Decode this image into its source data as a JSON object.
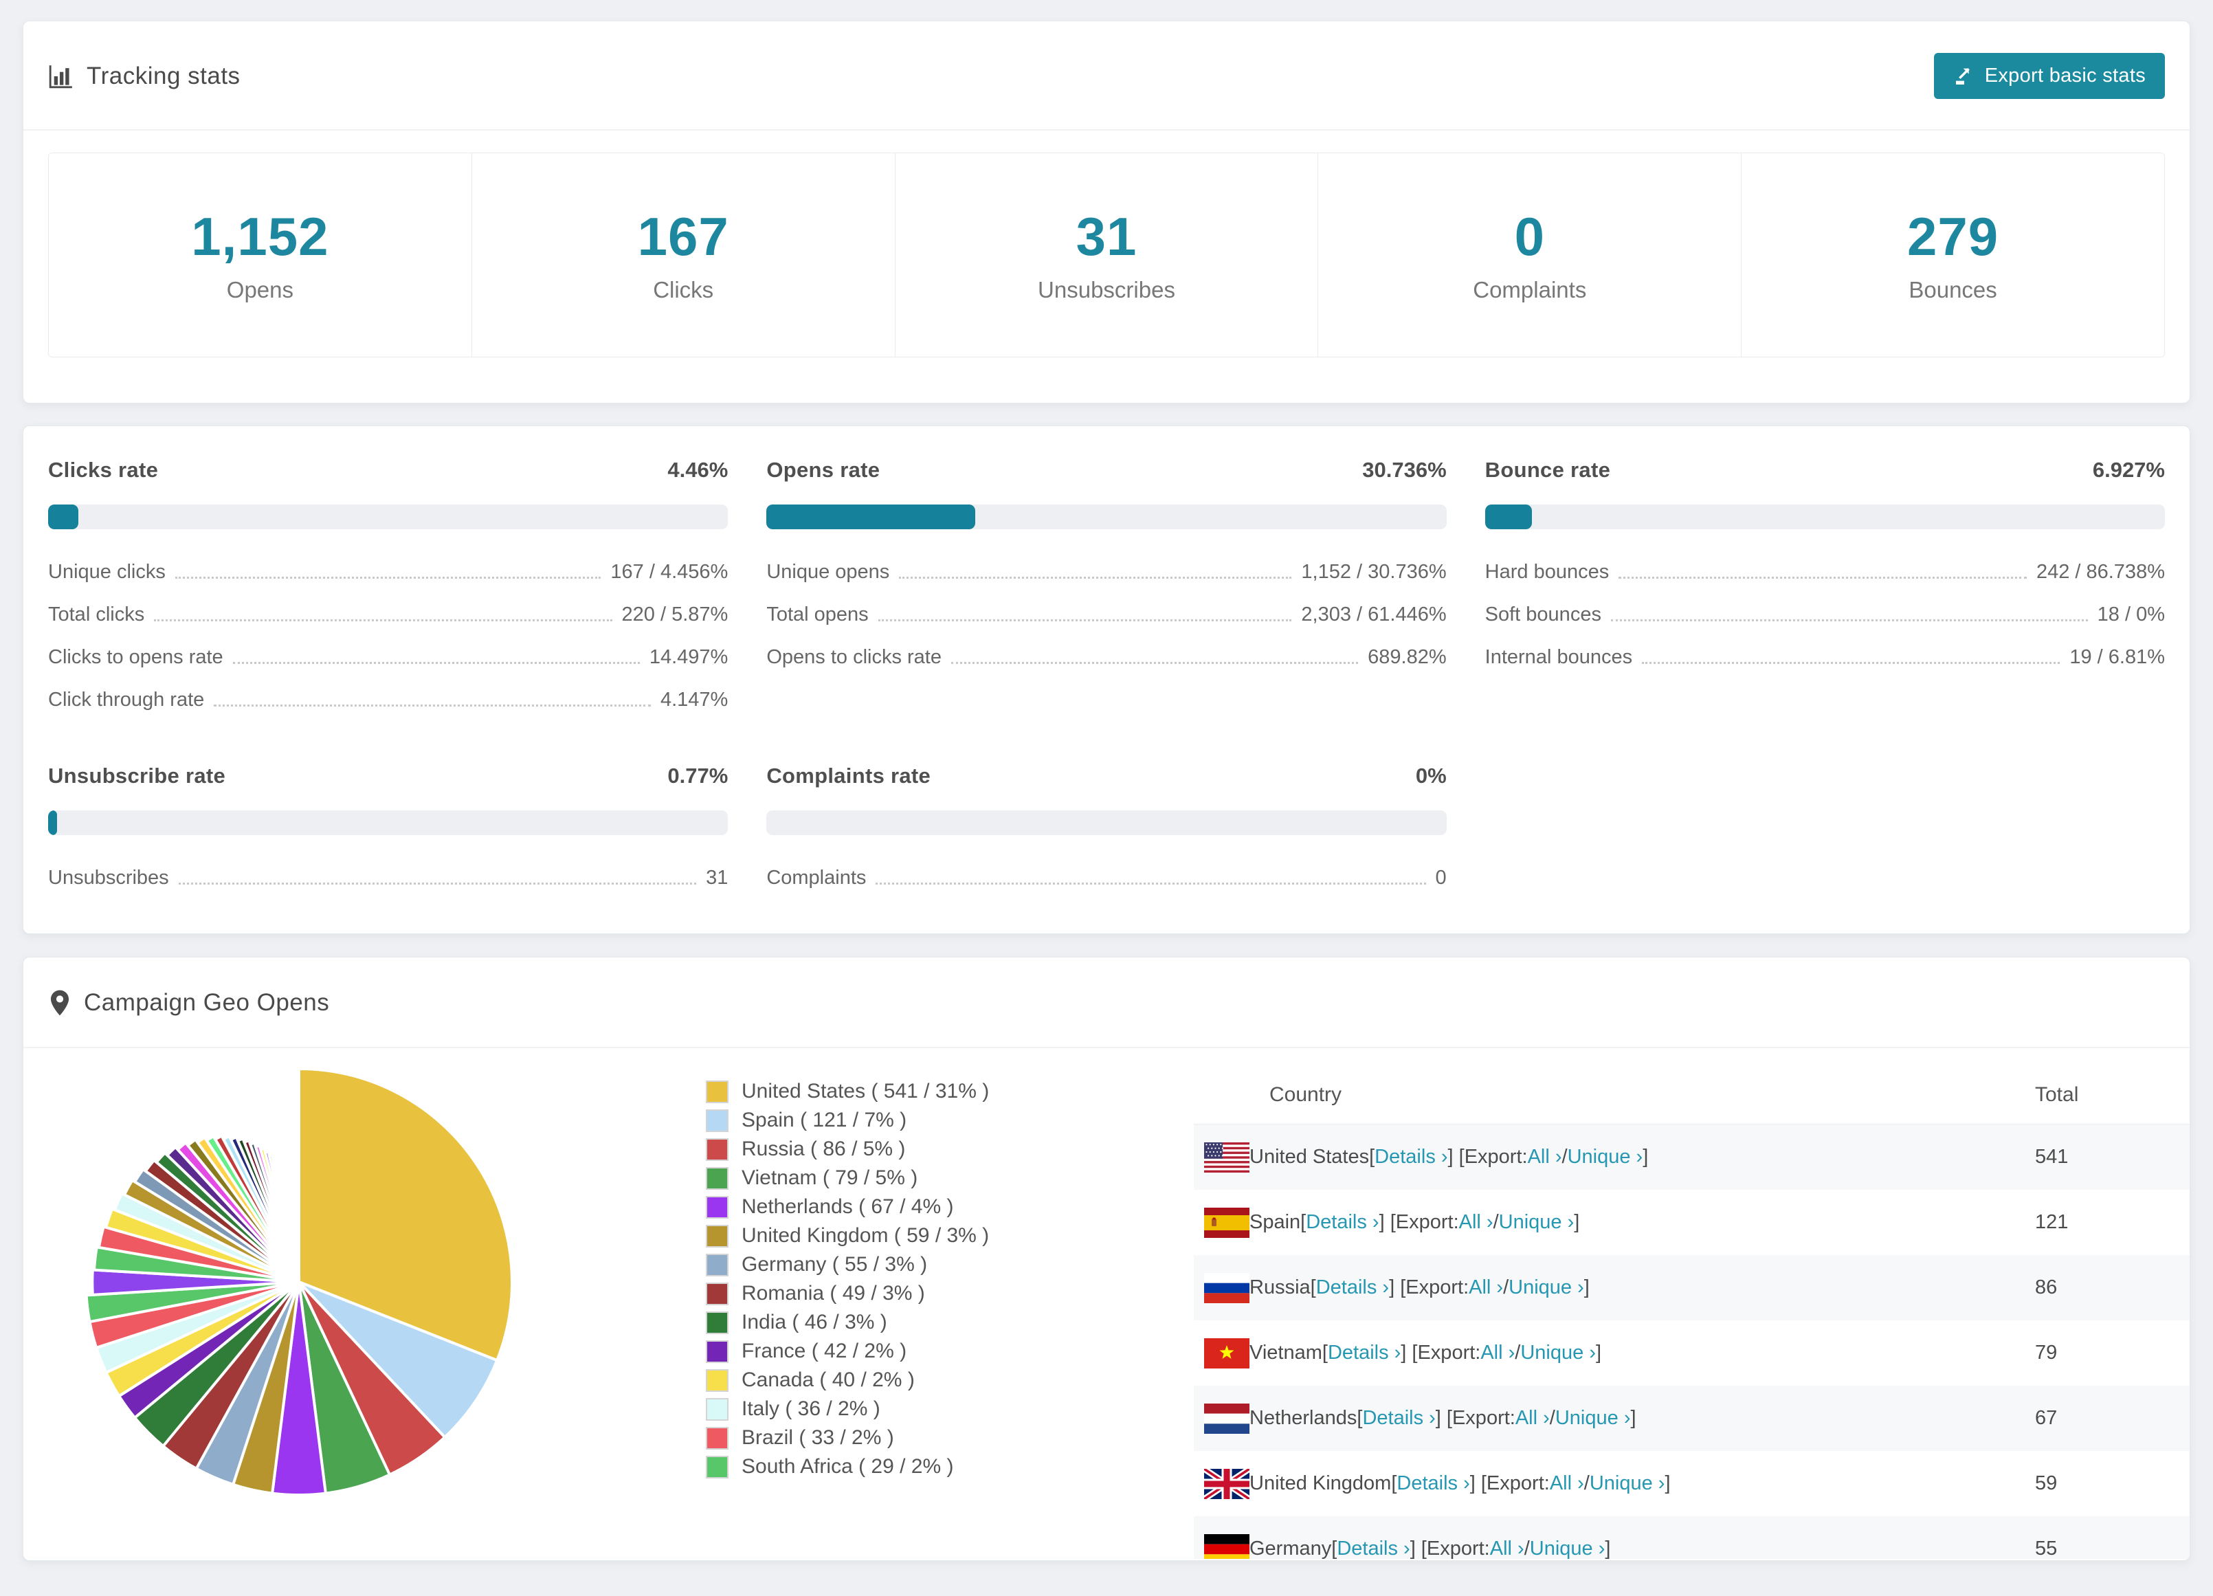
{
  "tracking": {
    "title": "Tracking stats",
    "export_button": "Export basic stats",
    "summary": [
      {
        "value": "1,152",
        "label": "Opens"
      },
      {
        "value": "167",
        "label": "Clicks"
      },
      {
        "value": "31",
        "label": "Unsubscribes"
      },
      {
        "value": "0",
        "label": "Complaints"
      },
      {
        "value": "279",
        "label": "Bounces"
      }
    ]
  },
  "rates": {
    "panels": [
      {
        "title": "Clicks rate",
        "value": "4.46%",
        "percent": 4.46,
        "rows": [
          {
            "label": "Unique clicks",
            "value": "167 / 4.456%"
          },
          {
            "label": "Total clicks",
            "value": "220 / 5.87%"
          },
          {
            "label": "Clicks to opens rate",
            "value": "14.497%"
          },
          {
            "label": "Click through rate",
            "value": "4.147%"
          }
        ]
      },
      {
        "title": "Opens rate",
        "value": "30.736%",
        "percent": 30.736,
        "rows": [
          {
            "label": "Unique opens",
            "value": "1,152 / 30.736%"
          },
          {
            "label": "Total opens",
            "value": "2,303 / 61.446%"
          },
          {
            "label": "Opens to clicks rate",
            "value": "689.82%"
          }
        ]
      },
      {
        "title": "Bounce rate",
        "value": "6.927%",
        "percent": 6.927,
        "rows": [
          {
            "label": "Hard bounces",
            "value": "242 / 86.738%"
          },
          {
            "label": "Soft bounces",
            "value": "18 / 0%"
          },
          {
            "label": "Internal bounces",
            "value": "19 / 6.81%"
          }
        ]
      },
      {
        "title": "Unsubscribe rate",
        "value": "0.77%",
        "percent": 0.77,
        "rows": [
          {
            "label": "Unsubscribes",
            "value": "31"
          }
        ]
      },
      {
        "title": "Complaints rate",
        "value": "0%",
        "percent": 0,
        "rows": [
          {
            "label": "Complaints",
            "value": "0"
          }
        ]
      }
    ]
  },
  "geo": {
    "title": "Campaign Geo Opens",
    "table": {
      "headers": {
        "country": "Country",
        "total": "Total"
      },
      "segments": {
        "pre_details": "[",
        "post_details": "] [Export: ",
        "mid": " / ",
        "end": "]"
      },
      "links": {
        "details": "Details ›",
        "all": "All ›",
        "unique": "Unique ›"
      },
      "rows": [
        {
          "flag": "us",
          "country": "United States",
          "total": "541"
        },
        {
          "flag": "es",
          "country": "Spain",
          "total": "121"
        },
        {
          "flag": "ru",
          "country": "Russia",
          "total": "86"
        },
        {
          "flag": "vn",
          "country": "Vietnam",
          "total": "79"
        },
        {
          "flag": "nl",
          "country": "Netherlands",
          "total": "67"
        },
        {
          "flag": "gb",
          "country": "United Kingdom",
          "total": "59"
        },
        {
          "flag": "de",
          "country": "Germany",
          "total": "55"
        }
      ]
    }
  },
  "chart_data": {
    "type": "pie",
    "title": "Campaign Geo Opens",
    "unit": "opens",
    "legend_position": "right",
    "slices": [
      {
        "label": "United States",
        "count": 541,
        "percent": 31,
        "color": "#e8c23e"
      },
      {
        "label": "Spain",
        "count": 121,
        "percent": 7,
        "color": "#b5d9f5"
      },
      {
        "label": "Russia",
        "count": 86,
        "percent": 5,
        "color": "#cc4a4a"
      },
      {
        "label": "Vietnam",
        "count": 79,
        "percent": 5,
        "color": "#4ba450"
      },
      {
        "label": "Netherlands",
        "count": 67,
        "percent": 4,
        "color": "#9a36f0"
      },
      {
        "label": "United Kingdom",
        "count": 59,
        "percent": 3,
        "color": "#b6952f"
      },
      {
        "label": "Germany",
        "count": 55,
        "percent": 3,
        "color": "#8fadca"
      },
      {
        "label": "Romania",
        "count": 49,
        "percent": 3,
        "color": "#a23939"
      },
      {
        "label": "India",
        "count": 46,
        "percent": 3,
        "color": "#2f7d38"
      },
      {
        "label": "France",
        "count": 42,
        "percent": 2,
        "color": "#7326b5"
      },
      {
        "label": "Canada",
        "count": 40,
        "percent": 2,
        "color": "#f6df4b"
      },
      {
        "label": "Italy",
        "count": 36,
        "percent": 2,
        "color": "#d9f9f9"
      },
      {
        "label": "Brazil",
        "count": 33,
        "percent": 2,
        "color": "#ef5a62"
      },
      {
        "label": "South Africa",
        "count": 29,
        "percent": 2,
        "color": "#57c769"
      }
    ],
    "others_percent": 26
  },
  "colors": {
    "accent": "#1b8a9e",
    "bar_fill": "#15819b",
    "bar_track": "#edeff2",
    "link": "#2697b2",
    "stat_number": "#1e87a0"
  }
}
